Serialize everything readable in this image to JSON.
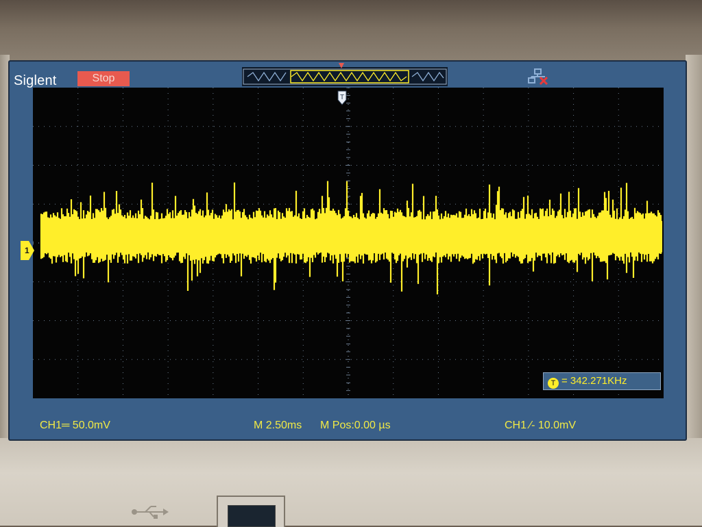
{
  "device": {
    "brand": "Siglent",
    "run_state": "Stop"
  },
  "colors": {
    "screen_bg": "#3a5f88",
    "grid_bg": "#050505",
    "channel1": "#ffee2a",
    "status_stop": "#e85a4f",
    "grid_lines": "#6b7c90"
  },
  "icons": {
    "network": "network-disconnected-icon",
    "trigger": "trigger-position-icon",
    "channel": "channel-1-marker-icon",
    "usb": "usb-icon"
  },
  "measurement": {
    "frequency": "= 342.271KHz"
  },
  "footer": {
    "ch1_scale": "CH1═ 50.0mV",
    "timebase": "M 2.50ms",
    "mpos": "M Pos:0.00 µs",
    "trigger": "CH1 ⁄- 10.0mV"
  },
  "waveform": {
    "channel": "CH1",
    "grid_divisions": {
      "horizontal": 14,
      "vertical": 8
    },
    "envelope_level_div": 0.3,
    "envelope_amplitude_div": 0.85
  }
}
